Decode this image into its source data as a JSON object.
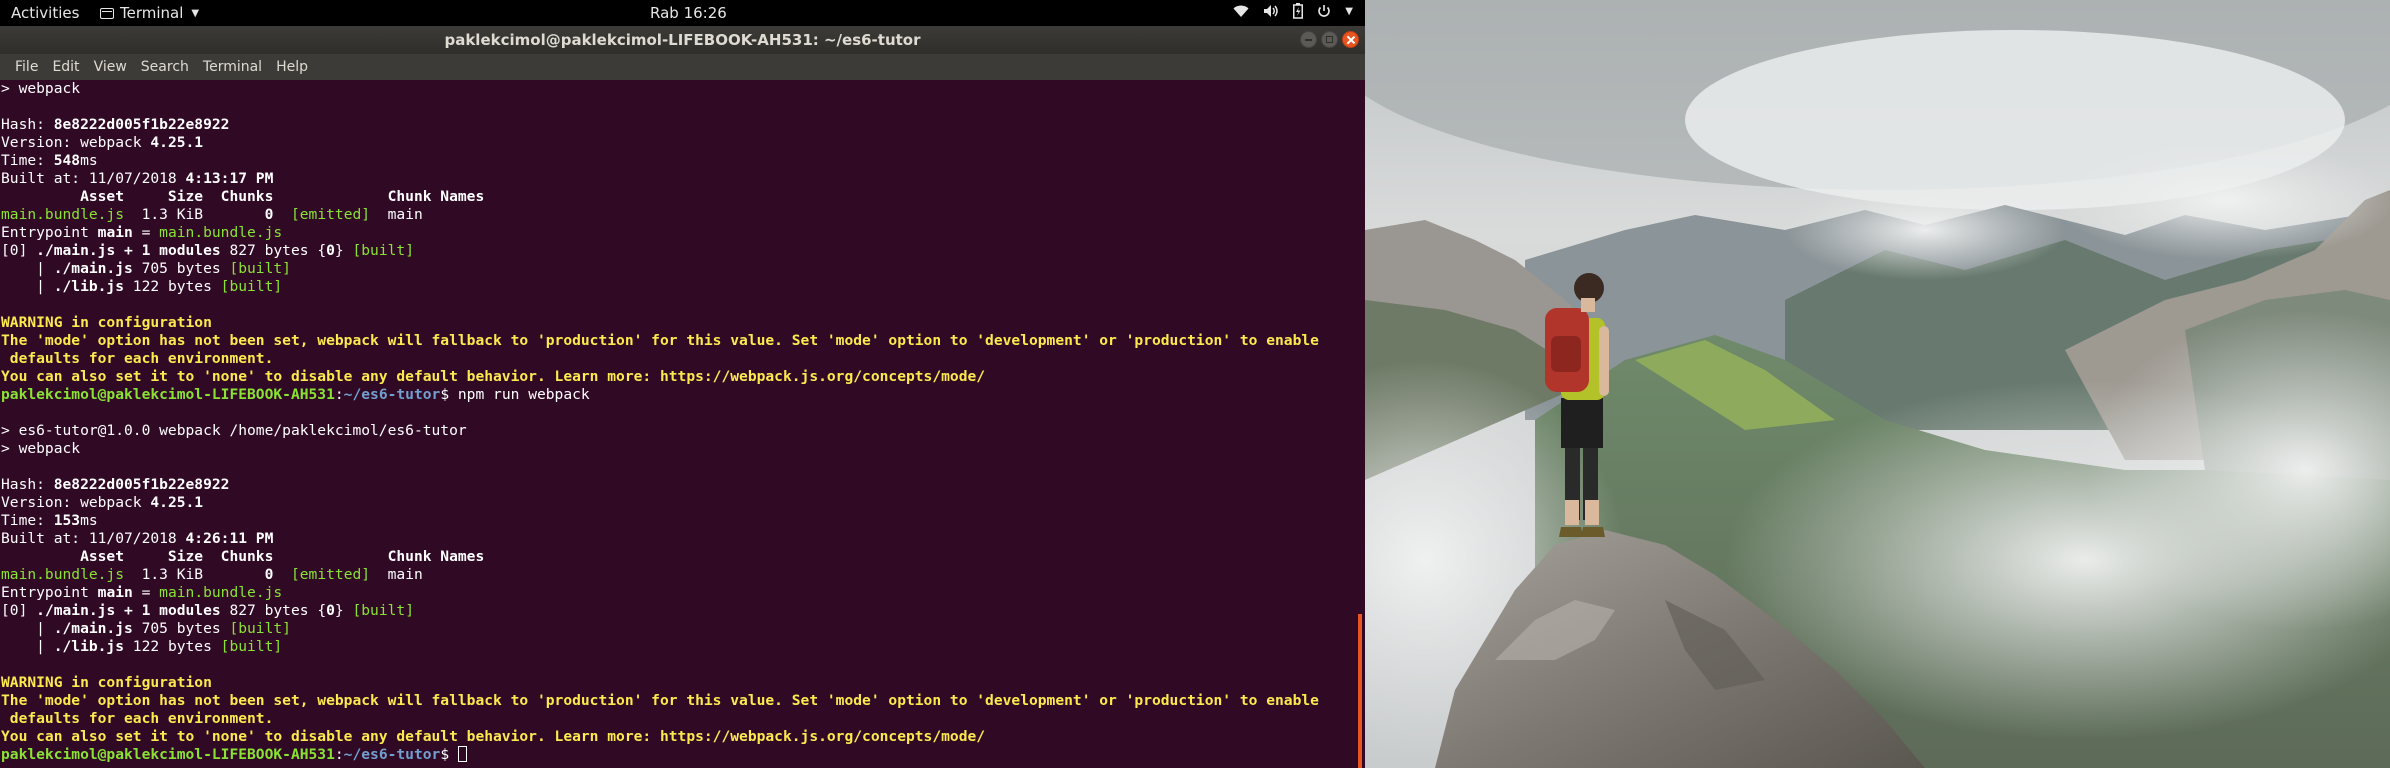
{
  "topbar": {
    "activities": "Activities",
    "app_menu": "Terminal",
    "clock": "Rab 16:26"
  },
  "window": {
    "title": "paklekcimol@paklekcimol-LIFEBOOK-AH531: ~/es6-tutor"
  },
  "menubar": {
    "items": [
      "File",
      "Edit",
      "View",
      "Search",
      "Terminal",
      "Help"
    ]
  },
  "terminal": {
    "lines": [
      [
        {
          "t": "> webpack"
        }
      ],
      [
        {
          "t": ""
        }
      ],
      [
        {
          "t": "Hash: "
        },
        {
          "t": "8e8222d005f1b22e8922",
          "c": "b"
        }
      ],
      [
        {
          "t": "Version: webpack "
        },
        {
          "t": "4.25.1",
          "c": "b"
        }
      ],
      [
        {
          "t": "Time: "
        },
        {
          "t": "548",
          "c": "b"
        },
        {
          "t": "ms"
        }
      ],
      [
        {
          "t": "Built at: 11/07/2018 "
        },
        {
          "t": "4:13:17 PM",
          "c": "b"
        }
      ],
      [
        {
          "t": "         Asset     Size  Chunks             Chunk Names",
          "c": "b"
        }
      ],
      [
        {
          "t": "main.bundle.js",
          "c": "g"
        },
        {
          "t": "  1.3 KiB       "
        },
        {
          "t": "0",
          "c": "b"
        },
        {
          "t": "  "
        },
        {
          "t": "[emitted]",
          "c": "g"
        },
        {
          "t": "  main"
        }
      ],
      [
        {
          "t": "Entrypoint "
        },
        {
          "t": "main",
          "c": "b"
        },
        {
          "t": " = "
        },
        {
          "t": "main.bundle.js",
          "c": "g"
        }
      ],
      [
        {
          "t": "[0] "
        },
        {
          "t": "./main.js + 1 modules",
          "c": "b"
        },
        {
          "t": " 827 bytes {"
        },
        {
          "t": "0",
          "c": "b"
        },
        {
          "t": "} "
        },
        {
          "t": "[built]",
          "c": "g"
        }
      ],
      [
        {
          "t": "    | "
        },
        {
          "t": "./main.js",
          "c": "b"
        },
        {
          "t": " 705 bytes "
        },
        {
          "t": "[built]",
          "c": "g"
        }
      ],
      [
        {
          "t": "    | "
        },
        {
          "t": "./lib.js",
          "c": "b"
        },
        {
          "t": " 122 bytes "
        },
        {
          "t": "[built]",
          "c": "g"
        }
      ],
      [
        {
          "t": ""
        }
      ],
      [
        {
          "t": "WARNING in configuration",
          "c": "y"
        }
      ],
      [
        {
          "t": "The 'mode' option has not been set, webpack will fallback to 'production' for this value. Set 'mode' option to 'development' or 'production' to enable",
          "c": "y"
        }
      ],
      [
        {
          "t": " defaults for each environment.",
          "c": "y"
        }
      ],
      [
        {
          "t": "You can also set it to 'none' to disable any default behavior. Learn more: https://webpack.js.org/concepts/mode/",
          "c": "y"
        }
      ],
      [
        {
          "t": "paklekcimol@paklekcimol-LIFEBOOK-AH531",
          "c": "gb"
        },
        {
          "t": ":"
        },
        {
          "t": "~/es6-tutor",
          "c": "blu"
        },
        {
          "t": "$ npm run webpack"
        }
      ],
      [
        {
          "t": ""
        }
      ],
      [
        {
          "t": "> es6-tutor@1.0.0 webpack /home/paklekcimol/es6-tutor"
        }
      ],
      [
        {
          "t": "> webpack"
        }
      ],
      [
        {
          "t": ""
        }
      ],
      [
        {
          "t": "Hash: "
        },
        {
          "t": "8e8222d005f1b22e8922",
          "c": "b"
        }
      ],
      [
        {
          "t": "Version: webpack "
        },
        {
          "t": "4.25.1",
          "c": "b"
        }
      ],
      [
        {
          "t": "Time: "
        },
        {
          "t": "153",
          "c": "b"
        },
        {
          "t": "ms"
        }
      ],
      [
        {
          "t": "Built at: 11/07/2018 "
        },
        {
          "t": "4:26:11 PM",
          "c": "b"
        }
      ],
      [
        {
          "t": "         Asset     Size  Chunks             Chunk Names",
          "c": "b"
        }
      ],
      [
        {
          "t": "main.bundle.js",
          "c": "g"
        },
        {
          "t": "  1.3 KiB       "
        },
        {
          "t": "0",
          "c": "b"
        },
        {
          "t": "  "
        },
        {
          "t": "[emitted]",
          "c": "g"
        },
        {
          "t": "  main"
        }
      ],
      [
        {
          "t": "Entrypoint "
        },
        {
          "t": "main",
          "c": "b"
        },
        {
          "t": " = "
        },
        {
          "t": "main.bundle.js",
          "c": "g"
        }
      ],
      [
        {
          "t": "[0] "
        },
        {
          "t": "./main.js + 1 modules",
          "c": "b"
        },
        {
          "t": " 827 bytes {"
        },
        {
          "t": "0",
          "c": "b"
        },
        {
          "t": "} "
        },
        {
          "t": "[built]",
          "c": "g"
        }
      ],
      [
        {
          "t": "    | "
        },
        {
          "t": "./main.js",
          "c": "b"
        },
        {
          "t": " 705 bytes "
        },
        {
          "t": "[built]",
          "c": "g"
        }
      ],
      [
        {
          "t": "    | "
        },
        {
          "t": "./lib.js",
          "c": "b"
        },
        {
          "t": " 122 bytes "
        },
        {
          "t": "[built]",
          "c": "g"
        }
      ],
      [
        {
          "t": ""
        }
      ],
      [
        {
          "t": "WARNING in configuration",
          "c": "y"
        }
      ],
      [
        {
          "t": "The 'mode' option has not been set, webpack will fallback to 'production' for this value. Set 'mode' option to 'development' or 'production' to enable",
          "c": "y"
        }
      ],
      [
        {
          "t": " defaults for each environment.",
          "c": "y"
        }
      ],
      [
        {
          "t": "You can also set it to 'none' to disable any default behavior. Learn more: https://webpack.js.org/concepts/mode/",
          "c": "y"
        }
      ],
      [
        {
          "t": "paklekcimol@paklekcimol-LIFEBOOK-AH531",
          "c": "gb"
        },
        {
          "t": ":"
        },
        {
          "t": "~/es6-tutor",
          "c": "blu"
        },
        {
          "t": "$ "
        },
        {
          "cursor": true
        }
      ]
    ]
  },
  "colors": {
    "terminal_bg": "#300a24",
    "accent": "#e95420",
    "green": "#8ae234",
    "yellow": "#fce94f",
    "blue": "#729fcf"
  },
  "icons": [
    "terminal-icon",
    "chevron-down-icon",
    "wifi-icon",
    "volume-icon",
    "battery-icon",
    "power-menu-icon",
    "minimize-icon",
    "maximize-icon",
    "close-icon"
  ]
}
